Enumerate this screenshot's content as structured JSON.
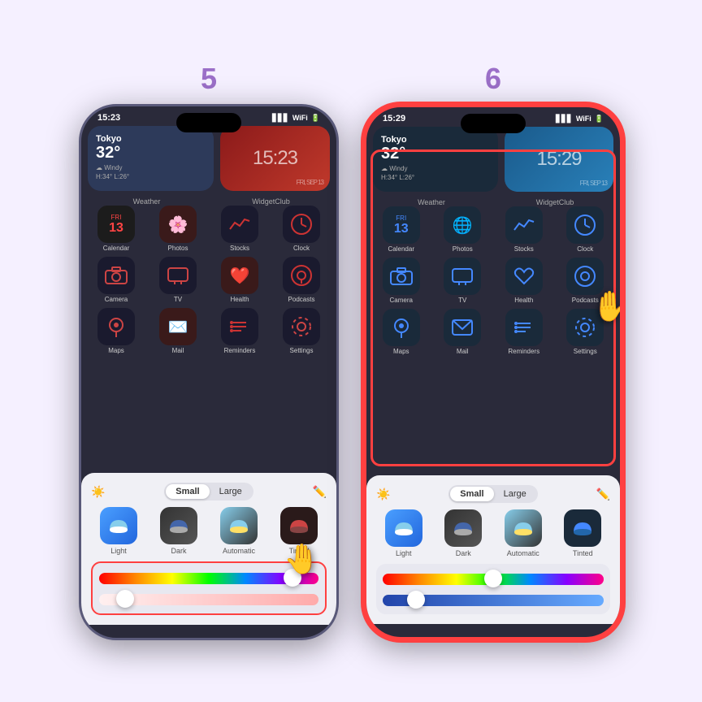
{
  "steps": [
    {
      "number": "5",
      "phone": {
        "time": "15:23",
        "theme": "red",
        "widgets": {
          "weather": {
            "city": "Tokyo",
            "temp": "32°",
            "desc": "Windy",
            "detail": "H:34° L:26°"
          },
          "clock": "15:23",
          "weather_label": "Weather",
          "clock_label": "WidgetClub"
        },
        "apps": [
          {
            "icon": "📅",
            "label": "Calendar",
            "bg": "#1a1a2e",
            "color": "#ff4444"
          },
          {
            "icon": "🌸",
            "label": "Photos",
            "bg": "#2a1a1a",
            "color": "#cc3333"
          },
          {
            "icon": "📈",
            "label": "Stocks",
            "bg": "#1a1a2e",
            "color": "#cc3333"
          },
          {
            "icon": "🕐",
            "label": "Clock",
            "bg": "#1a1a2e",
            "color": "#cc3333"
          },
          {
            "icon": "📷",
            "label": "Camera",
            "bg": "#1a1a2e",
            "color": "#cc4444"
          },
          {
            "icon": "📺",
            "label": "TV",
            "bg": "#1a1a2e",
            "color": "#cc4444"
          },
          {
            "icon": "❤️",
            "label": "Health",
            "bg": "#2a1a1a",
            "color": "#cc3333"
          },
          {
            "icon": "🎙",
            "label": "Podcasts",
            "bg": "#1a1a2e",
            "color": "#cc3333"
          },
          {
            "icon": "🔍",
            "label": "Maps",
            "bg": "#1a1a2e",
            "color": "#cc4444"
          },
          {
            "icon": "✉️",
            "label": "Mail",
            "bg": "#2a1a1a",
            "color": "#cc3333"
          },
          {
            "icon": "⠿",
            "label": "Reminders",
            "bg": "#1a1a2e",
            "color": "#cc3333"
          },
          {
            "icon": "⚙️",
            "label": "Settings",
            "bg": "#1a1a2e",
            "color": "#cc4444"
          }
        ]
      },
      "panel": {
        "size_small": "Small",
        "size_large": "Large",
        "options": [
          "Light",
          "Dark",
          "Automatic",
          "Tinted"
        ],
        "active_size": "Small",
        "slider_pos1": 90,
        "slider_pos2": 12,
        "highlighted": true
      }
    },
    {
      "number": "6",
      "phone": {
        "time": "15:29",
        "theme": "blue",
        "highlighted": true,
        "widgets": {
          "weather": {
            "city": "Tokyo",
            "temp": "32°",
            "desc": "Windy",
            "detail": "H:34° L:26°"
          },
          "clock": "15:29",
          "weather_label": "Weather",
          "clock_label": "WidgetClub"
        },
        "apps": [
          {
            "icon": "📅",
            "label": "Calendar",
            "bg": "#1a1a2e",
            "color": "#4488ff"
          },
          {
            "icon": "🌸",
            "label": "Photos",
            "bg": "#1a2a3a",
            "color": "#4488ff"
          },
          {
            "icon": "📈",
            "label": "Stocks",
            "bg": "#1a2a3a",
            "color": "#4488ff"
          },
          {
            "icon": "🕐",
            "label": "Clock",
            "bg": "#1a2a3a",
            "color": "#4488ff"
          },
          {
            "icon": "📷",
            "label": "Camera",
            "bg": "#1a2a3a",
            "color": "#4488ff"
          },
          {
            "icon": "📺",
            "label": "TV",
            "bg": "#1a2a3a",
            "color": "#4488ff"
          },
          {
            "icon": "❤️",
            "label": "Health",
            "bg": "#1a2a3a",
            "color": "#4488ff"
          },
          {
            "icon": "🎙",
            "label": "Podcasts",
            "bg": "#1a2a3a",
            "color": "#4488ff"
          },
          {
            "icon": "🔍",
            "label": "Maps",
            "bg": "#1a2a3a",
            "color": "#4488ff"
          },
          {
            "icon": "✉️",
            "label": "Mail",
            "bg": "#1a2a3a",
            "color": "#4488ff"
          },
          {
            "icon": "⠿",
            "label": "Reminders",
            "bg": "#1a2a3a",
            "color": "#4488ff"
          },
          {
            "icon": "⚙️",
            "label": "Settings",
            "bg": "#1a2a3a",
            "color": "#4488ff"
          }
        ]
      },
      "panel": {
        "size_small": "Small",
        "size_large": "Large",
        "options": [
          "Light",
          "Dark",
          "Automatic",
          "Tinted"
        ],
        "active_size": "Small",
        "slider_pos1": 50,
        "slider_pos2": 15,
        "highlighted": false
      }
    }
  ],
  "icon_options_red": [
    {
      "label": "Light",
      "type": "light"
    },
    {
      "label": "Dark",
      "type": "dark"
    },
    {
      "label": "Automatic",
      "type": "auto"
    },
    {
      "label": "Tinted",
      "type": "tinted-red"
    }
  ],
  "icon_options_blue": [
    {
      "label": "Light",
      "type": "light"
    },
    {
      "label": "Dark",
      "type": "dark"
    },
    {
      "label": "Automatic",
      "type": "auto"
    },
    {
      "label": "Tinted",
      "type": "tinted-blue"
    }
  ]
}
